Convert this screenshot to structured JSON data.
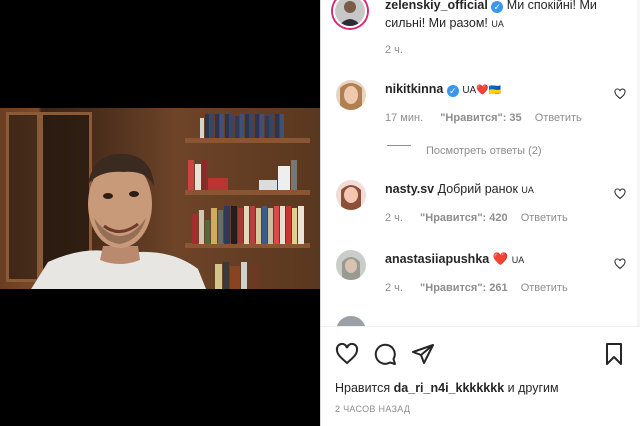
{
  "post": {
    "author": "zelenskiy_official",
    "caption_line1": "Ми спокійні! Ми",
    "caption_line2": "сильні! Ми разом!",
    "caption_flag": "UA",
    "time": "2 ч."
  },
  "comments": [
    {
      "user": "nikitkinna",
      "verified": true,
      "text": "UA❤️🇺🇦",
      "time": "17 мин.",
      "likes": "\"Нравится\": 35",
      "reply": "Ответить",
      "view_replies": "Посмотреть ответы (2)"
    },
    {
      "user": "nasty.sv",
      "text": "Добрий ранок",
      "flag": "UA",
      "time": "2 ч.",
      "likes": "\"Нравится\": 420",
      "reply": "Ответить"
    },
    {
      "user": "anastasiiapushka",
      "text": "❤️",
      "flag": "UA",
      "time": "2 ч.",
      "likes": "\"Нравится\": 261",
      "reply": "Ответить"
    }
  ],
  "footer": {
    "likes_prefix": "Нравится",
    "likes_user": "da_ri_n4i_kkkkkkk",
    "likes_suffix": "и другим",
    "timestamp": "2 ЧАСОВ НАЗАД"
  },
  "icons": {
    "like": "heart-icon",
    "comment": "comment-icon",
    "share": "send-icon",
    "save": "bookmark-icon"
  }
}
